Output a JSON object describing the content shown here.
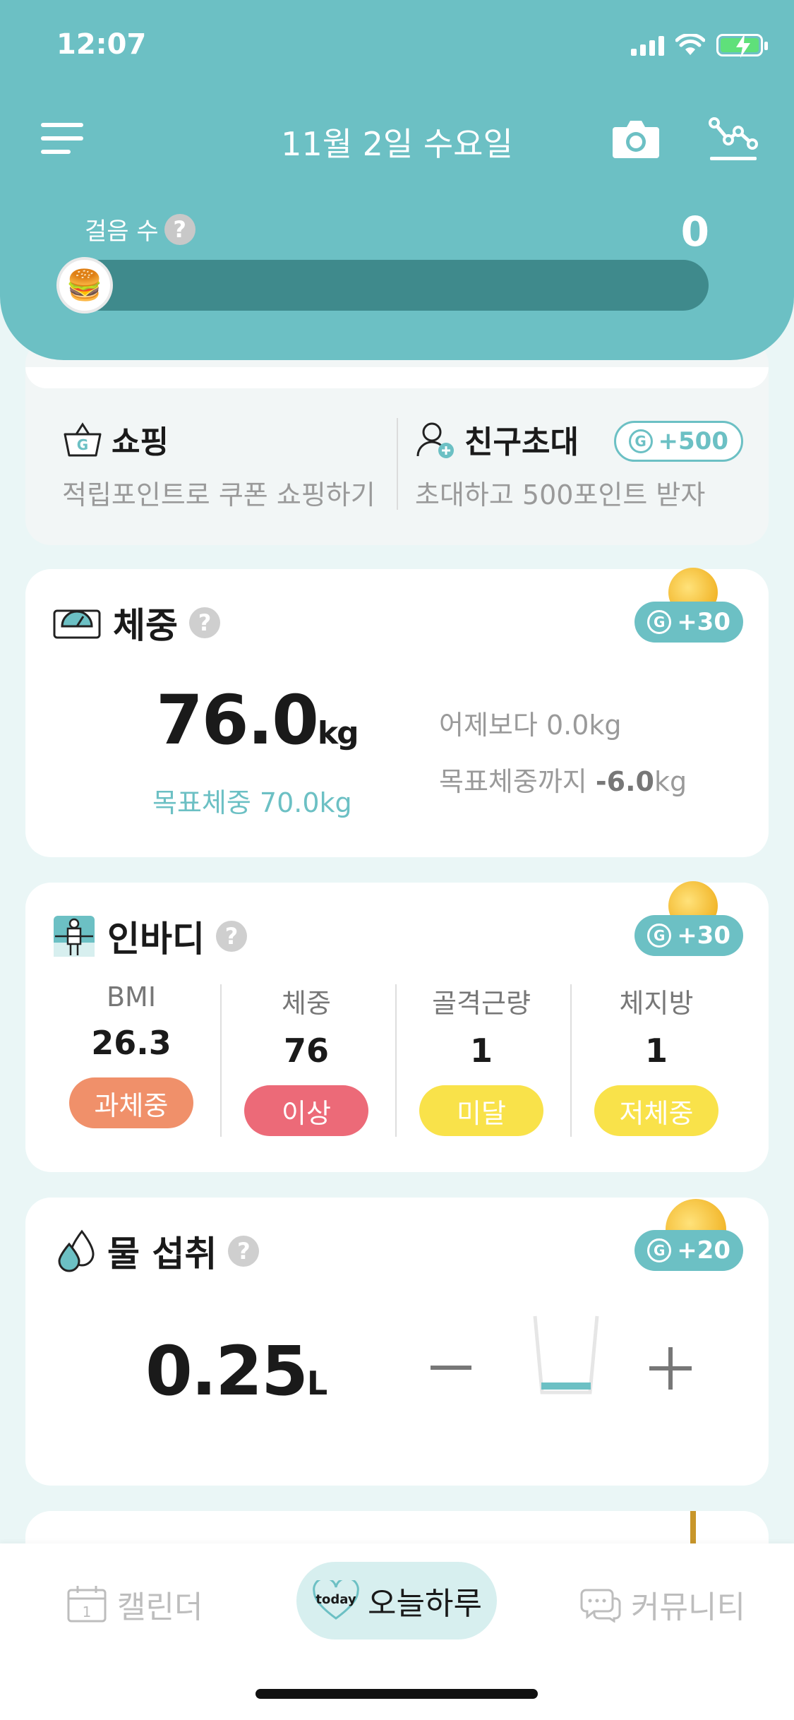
{
  "status": {
    "time": "12:07"
  },
  "header": {
    "date": "11월 2일 수요일",
    "steps_label": "걸음 수",
    "steps_help": "?",
    "steps_count": "0",
    "steps_progress": 0
  },
  "shortcuts": {
    "shopping": {
      "title": "쇼핑",
      "subtitle": "적립포인트로 쿠폰 쇼핑하기"
    },
    "invite": {
      "title": "친구초대",
      "subtitle": "초대하고 500포인트 받자",
      "reward": "+500"
    }
  },
  "weight": {
    "title": "체중",
    "help": "?",
    "reward": "+30",
    "value": "76.0",
    "unit": "kg",
    "goal": "목표체중 70.0kg",
    "vs_yesterday_label": "어제보다",
    "vs_yesterday_value": "0.0kg",
    "to_goal_label": "목표체중까지",
    "to_goal_value": "-6.0",
    "to_goal_unit": "kg"
  },
  "inbody": {
    "title": "인바디",
    "help": "?",
    "reward": "+30",
    "stats": [
      {
        "label": "BMI",
        "value": "26.3",
        "status": "과체중",
        "color": "#f0906a"
      },
      {
        "label": "체중",
        "value": "76",
        "status": "이상",
        "color": "#ec6a78"
      },
      {
        "label": "골격근량",
        "value": "1",
        "status": "미달",
        "color": "#f9e24a"
      },
      {
        "label": "체지방",
        "value": "1",
        "status": "저체중",
        "color": "#f9e24a"
      }
    ]
  },
  "water": {
    "title": "물 섭취",
    "help": "?",
    "reward": "+20",
    "value": "0.25",
    "unit": "L",
    "fill_level": 0.1
  },
  "tabs": {
    "calendar": "캘린더",
    "today_badge": "today",
    "today": "오늘하루",
    "community": "커뮤니티"
  },
  "colors": {
    "accent": "#6cc0c4",
    "header_bg": "#6cc0c4",
    "progress_track": "#3f8a8c"
  }
}
